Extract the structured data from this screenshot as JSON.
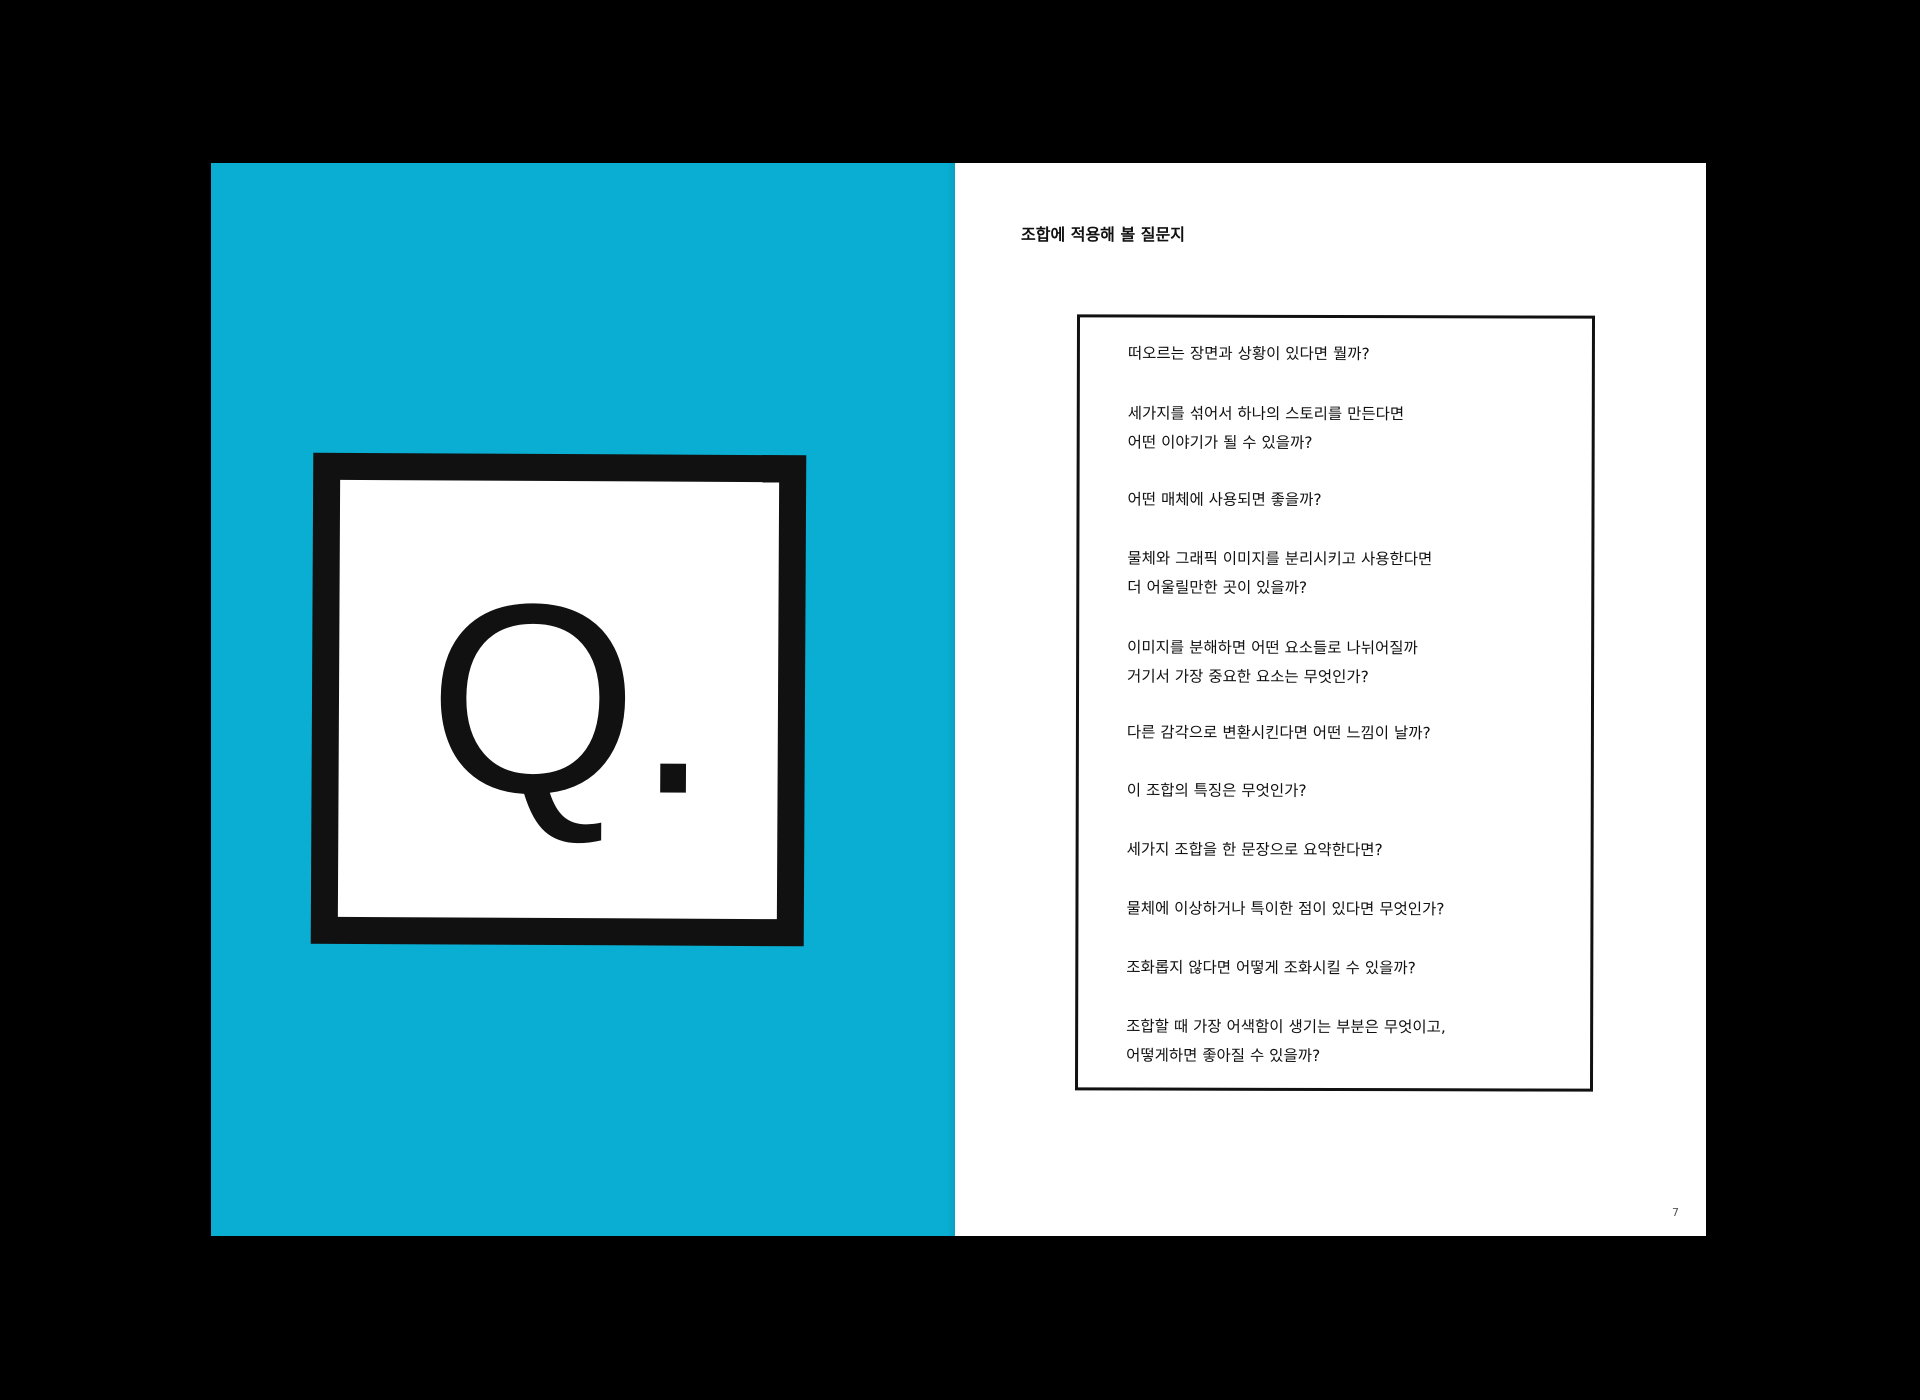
{
  "left_page": {
    "emblem": {
      "letter": "Q."
    }
  },
  "right_page": {
    "heading": "조합에 적용해 볼 질문지",
    "questions": [
      {
        "lines": [
          "떠오르는 장면과 상황이 있다면 뭘까?"
        ]
      },
      {
        "lines": [
          "세가지를 섞어서 하나의 스토리를 만든다면",
          "어떤 이야기가 될 수 있을까?"
        ]
      },
      {
        "lines": [
          "어떤 매체에 사용되면 좋을까?"
        ]
      },
      {
        "lines": [
          "물체와 그래픽 이미지를 분리시키고 사용한다면",
          "더 어울릴만한 곳이 있을까?"
        ]
      },
      {
        "lines": [
          "이미지를 분해하면 어떤 요소들로 나뉘어질까",
          "거기서 가장 중요한 요소는 무엇인가?"
        ]
      },
      {
        "lines": [
          "다른 감각으로 변환시킨다면 어떤 느낌이 날까?"
        ]
      },
      {
        "lines": [
          "이 조합의 특징은 무엇인가?"
        ]
      },
      {
        "lines": [
          "세가지 조합을 한 문장으로 요약한다면?"
        ]
      },
      {
        "lines": [
          "물체에 이상하거나 특이한 점이 있다면 무엇인가?"
        ]
      },
      {
        "lines": [
          "조화롭지 않다면 어떻게 조화시킬 수 있을까?"
        ]
      },
      {
        "lines": [
          "조합할 때 가장 어색함이 생기는 부분은 무엇이고,",
          "어떻게하면 좋아질 수 있을까?"
        ]
      }
    ],
    "page_number": "7"
  },
  "colors": {
    "background": "#000000",
    "left_page": "#0AAED3",
    "right_page": "#FFFFFF",
    "ink": "#111111"
  }
}
